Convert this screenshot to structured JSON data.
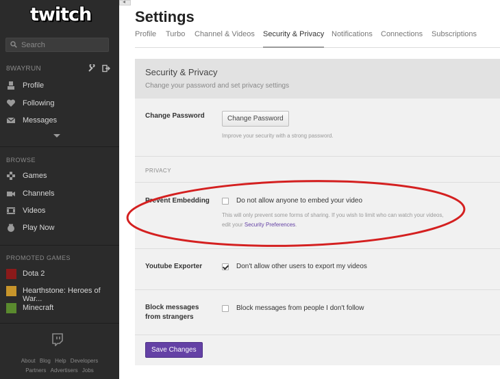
{
  "sidebar": {
    "logo": "twitch",
    "search_placeholder": "Search",
    "username": "8WAYRUN",
    "user_nav": [
      {
        "label": "Profile",
        "icon": "user-icon"
      },
      {
        "label": "Following",
        "icon": "heart-icon"
      },
      {
        "label": "Messages",
        "icon": "envelope-icon"
      }
    ],
    "browse_heading": "BROWSE",
    "browse": [
      {
        "label": "Games",
        "icon": "gamepad-icon"
      },
      {
        "label": "Channels",
        "icon": "camera-icon"
      },
      {
        "label": "Videos",
        "icon": "film-icon"
      },
      {
        "label": "Play Now",
        "icon": "play-now-icon"
      }
    ],
    "promoted_heading": "PROMOTED GAMES",
    "promoted": [
      {
        "label": "Dota 2",
        "color": "#8b1a1a"
      },
      {
        "label": "Hearthstone: Heroes of War...",
        "color": "#c7952b"
      },
      {
        "label": "Minecraft",
        "color": "#5a8a2e"
      }
    ],
    "footer": {
      "row1": [
        "About",
        "Blog",
        "Help",
        "Developers"
      ],
      "row2": [
        "Partners",
        "Advertisers",
        "Jobs"
      ]
    }
  },
  "main": {
    "title": "Settings",
    "tabs": [
      {
        "label": "Profile"
      },
      {
        "label": "Turbo"
      },
      {
        "label": "Channel & Videos"
      },
      {
        "label": "Security & Privacy",
        "active": true
      },
      {
        "label": "Notifications"
      },
      {
        "label": "Connections"
      },
      {
        "label": "Subscriptions"
      }
    ],
    "panel": {
      "title": "Security & Privacy",
      "subtitle": "Change your password and set privacy settings",
      "change_password": {
        "label": "Change Password",
        "button": "Change Password",
        "hint": "Improve your security with a strong password."
      },
      "privacy_heading": "PRIVACY",
      "prevent_embedding": {
        "label": "Prevent Embedding",
        "checkbox": "Do not allow anyone to embed your video",
        "checked": false,
        "hint_line1": "This will only prevent some forms of sharing. If you wish to limit who can watch your videos,",
        "hint_prefix": "edit your ",
        "hint_link": "Security Preferences",
        "hint_suffix": "."
      },
      "youtube_exporter": {
        "label": "Youtube Exporter",
        "checkbox": "Don't allow other users to export my videos",
        "checked": true
      },
      "block_messages": {
        "label_line1": "Block messages",
        "label_line2": "from strangers",
        "checkbox": "Block messages from people I don't follow",
        "checked": false
      },
      "save_button": "Save Changes"
    },
    "annotation_color": "#d42020"
  },
  "colors": {
    "sidebar_bg": "#2b2b2b",
    "accent": "#6441a5",
    "panel_bg": "#f1f1f1"
  }
}
